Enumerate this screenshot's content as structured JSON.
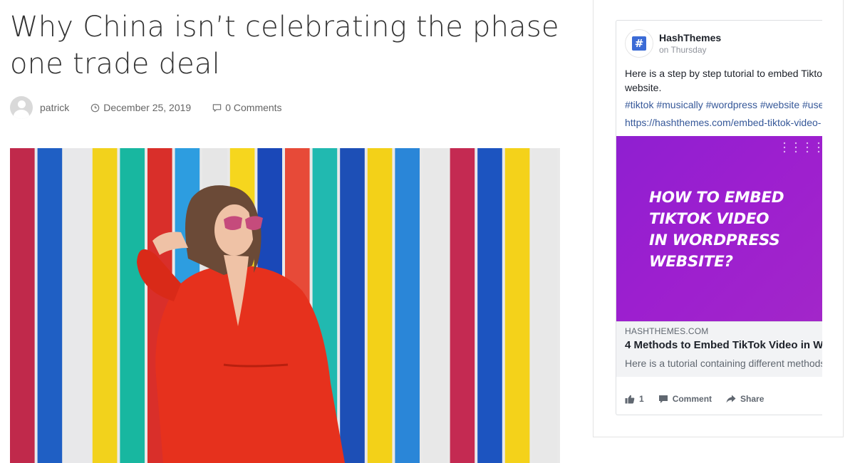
{
  "post": {
    "title": "Why China isn’t celebrating the phase one trade deal",
    "author": "patrick",
    "date": "December 25, 2019",
    "comments": "0 Comments"
  },
  "facebook_post": {
    "page_name": "HashThemes",
    "posted": "on Thursday",
    "text_line1": "Here is a step by step tutorial to embed Tiktok",
    "text_line2": "website.",
    "hashtags": "#tiktok #musically #wordpress #website #user",
    "link": "https://hashthemes.com/embed-tiktok-video-",
    "image_headline": [
      "HOW TO EMBED",
      "TIKTOK VIDEO",
      "IN WORDPRESS",
      "WEBSITE?"
    ],
    "card_domain": "HASHTHEMES.COM",
    "card_title": "4 Methods to Embed TikTok Video in W",
    "card_desc": "Here is a tutorial containing different methods",
    "likes": "1",
    "comment_label": "Comment",
    "share_label": "Share"
  },
  "icons": {
    "avatar": "user-avatar-icon",
    "date": "clock-icon",
    "comments": "comment-bubble-icon",
    "page_logo": "hash-icon",
    "like": "thumbs-up-icon",
    "comment": "speech-bubble-icon",
    "share": "share-arrow-icon"
  },
  "colors": {
    "link": "#365899",
    "fb_image_bg": "#9b22cf",
    "text_dark": "#333333"
  }
}
